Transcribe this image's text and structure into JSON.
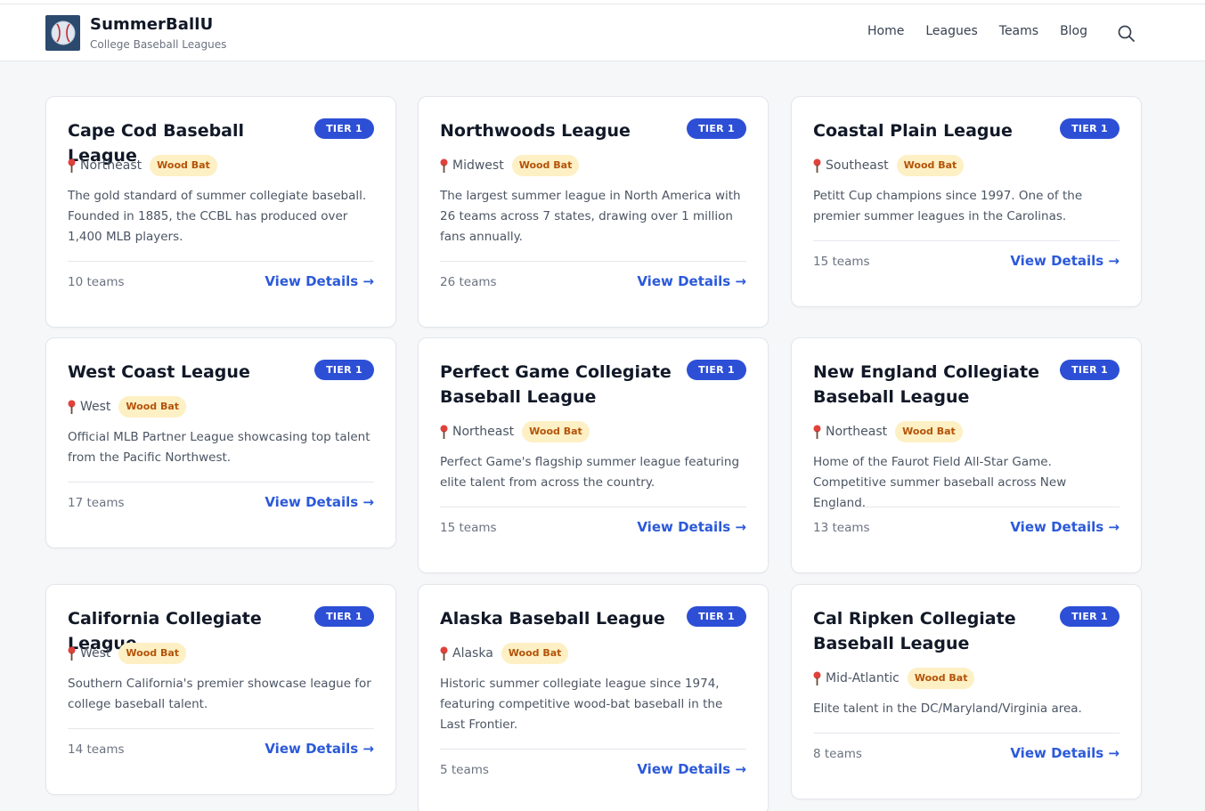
{
  "brand": {
    "name": "SummerBallU",
    "tagline": "College Baseball Leagues"
  },
  "nav": {
    "items": [
      "Home",
      "Leagues",
      "Teams",
      "Blog"
    ]
  },
  "colors": {
    "accent": "#2b59d9",
    "tier_badge": "#2d4fd6",
    "woodbat_bg": "#fdf0c4",
    "woodbat_text": "#b45309"
  },
  "leagues": [
    {
      "name": "Cape Cod Baseball League",
      "tier": "TIER 1",
      "region": "Northeast",
      "bat": "Wood Bat",
      "description": "The gold standard of summer collegiate baseball. Founded in 1885, the CCBL has produced over 1,400 MLB players.",
      "teams": "10 teams",
      "link": "View Details →"
    },
    {
      "name": "Northwoods League",
      "tier": "TIER 1",
      "region": "Midwest",
      "bat": "Wood Bat",
      "description": "The largest summer league in North America with 26 teams across 7 states, drawing over 1 million fans annually.",
      "teams": "26 teams",
      "link": "View Details →"
    },
    {
      "name": "Coastal Plain League",
      "tier": "TIER 1",
      "region": "Southeast",
      "bat": "Wood Bat",
      "description": "Petitt Cup champions since 1997. One of the premier summer leagues in the Carolinas.",
      "teams": "15 teams",
      "link": "View Details →"
    },
    {
      "name": "West Coast League",
      "tier": "TIER 1",
      "region": "West",
      "bat": "Wood Bat",
      "description": "Official MLB Partner League showcasing top talent from the Pacific Northwest.",
      "teams": "17 teams",
      "link": "View Details →"
    },
    {
      "name": "Perfect Game Collegiate Baseball League",
      "tier": "TIER 1",
      "region": "Northeast",
      "bat": "Wood Bat",
      "description": "Perfect Game's flagship summer league featuring elite talent from across the country.",
      "teams": "15 teams",
      "link": "View Details →"
    },
    {
      "name": "New England Collegiate Baseball League",
      "tier": "TIER 1",
      "region": "Northeast",
      "bat": "Wood Bat",
      "description": "Home of the Faurot Field All-Star Game. Competitive summer baseball across New England.",
      "teams": "13 teams",
      "link": "View Details →"
    },
    {
      "name": "California Collegiate League",
      "tier": "TIER 1",
      "region": "West",
      "bat": "Wood Bat",
      "description": "Southern California's premier showcase league for college baseball talent.",
      "teams": "14 teams",
      "link": "View Details →"
    },
    {
      "name": "Alaska Baseball League",
      "tier": "TIER 1",
      "region": "Alaska",
      "bat": "Wood Bat",
      "description": "Historic summer collegiate league since 1974, featuring competitive wood-bat baseball in the Last Frontier.",
      "teams": "5 teams",
      "link": "View Details →"
    },
    {
      "name": "Cal Ripken Collegiate Baseball League",
      "tier": "TIER 1",
      "region": "Mid-Atlantic",
      "bat": "Wood Bat",
      "description": "Elite talent in the DC/Maryland/Virginia area.",
      "teams": "8 teams",
      "link": "View Details →"
    }
  ]
}
